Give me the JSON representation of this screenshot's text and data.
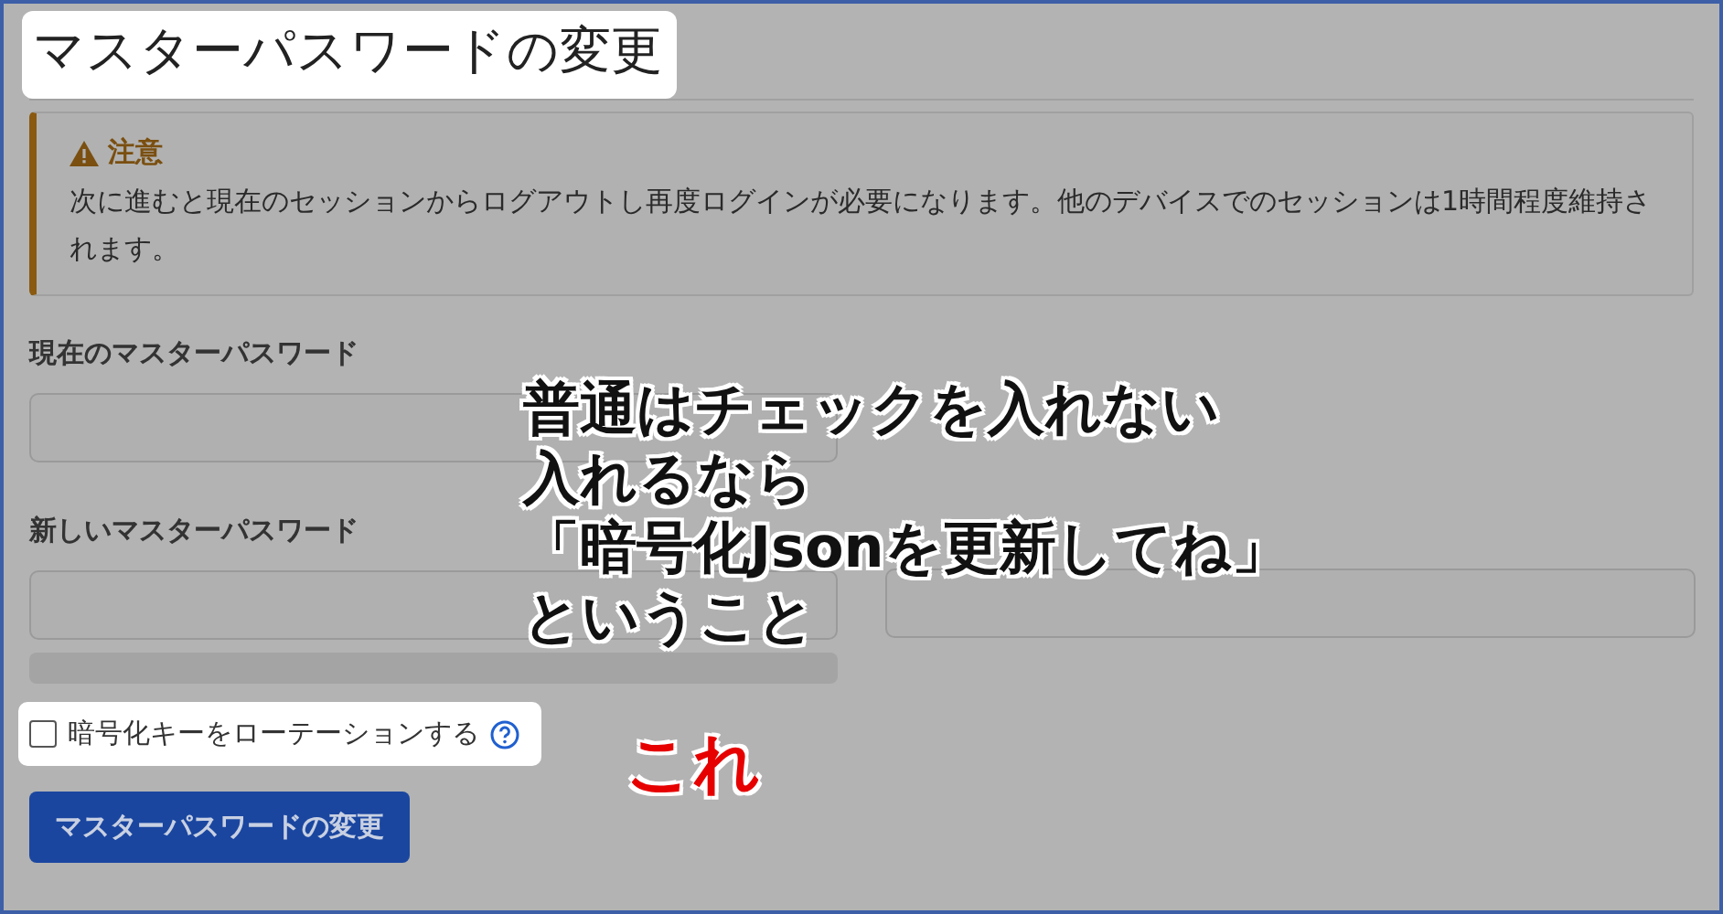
{
  "title": "マスターパスワードの変更",
  "alert": {
    "heading": "注意",
    "body": "次に進むと現在のセッションからログアウトし再度ログインが必要になります。他のデバイスでのセッションは1時間程度維持されます。"
  },
  "fields": [
    {
      "label": "現在のマスターパスワード"
    },
    {
      "label": "新しいマスターパスワード"
    }
  ],
  "rotate_key": {
    "label": "暗号化キーをローテーションする",
    "checked": false
  },
  "submit": "マスターパスワードの変更",
  "annotations": [
    {
      "kind": "note",
      "lines": [
        "普通はチェックを入れない",
        "入れるなら",
        "「暗号化Jsonを更新してね」",
        "ということ"
      ]
    },
    {
      "kind": "pointer",
      "lines": [
        "これ"
      ]
    }
  ]
}
